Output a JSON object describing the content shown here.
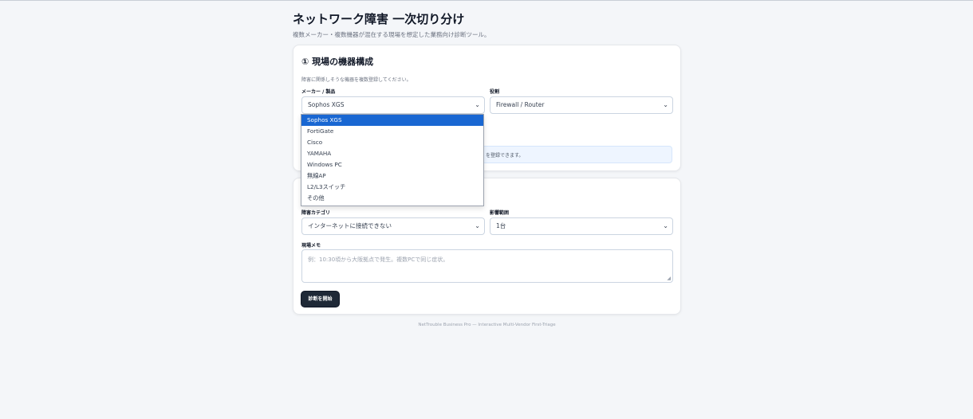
{
  "header": {
    "title": "ネットワーク障害 一次切り分け",
    "subtitle": "複数メーカー・複数機器が混在する現場を想定した業務向け診断ツール。"
  },
  "section1": {
    "heading": "① 現場の機器構成",
    "hint": "障害に関係しそうな機器を複数登録してください。",
    "vendor_label": "メーカー / 製品",
    "vendor_value": "Sophos XGS",
    "role_label": "役割",
    "role_value": "Firewall / Router",
    "info_text": "を登録できます。"
  },
  "dropdown": {
    "options": [
      "Sophos XGS",
      "FortiGate",
      "Cisco",
      "YAMAHA",
      "Windows PC",
      "無線AP",
      "L2/L3スイッチ",
      "その他"
    ],
    "selected_index": 0
  },
  "section2": {
    "category_label": "障害カテゴリ",
    "category_value": "インターネットに接続できない",
    "scope_label": "影響範囲",
    "scope_value": "1台",
    "memo_label": "現場メモ",
    "memo_placeholder": "例：10:30頃から大阪拠点で発生。複数PCで同じ症状。",
    "submit_label": "診断を開始"
  },
  "footer": {
    "text": "NetTrouble Business Pro — Interactive Multi-Vendor First-Triage"
  },
  "colors": {
    "accent": "#1967d2",
    "button": "#1f2937",
    "background": "#f4f6f9",
    "info_bg": "#eef5ff"
  },
  "icons": {
    "select_chevron": "chevron-down-icon",
    "textarea_grip": "resize-grip-icon"
  }
}
